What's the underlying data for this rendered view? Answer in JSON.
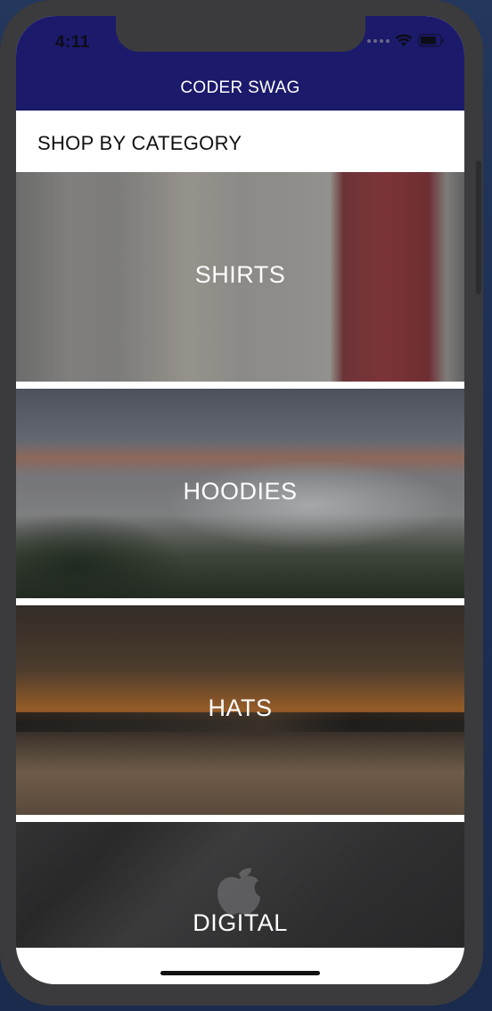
{
  "status_bar": {
    "time": "4:11",
    "icons": [
      "signal-dots-icon",
      "wifi-icon",
      "battery-icon"
    ]
  },
  "nav": {
    "title": "CODER SWAG"
  },
  "section": {
    "title": "SHOP BY CATEGORY"
  },
  "categories": [
    {
      "label": "SHIRTS"
    },
    {
      "label": "HOODIES"
    },
    {
      "label": "HATS"
    },
    {
      "label": "DIGITAL"
    }
  ],
  "colors": {
    "nav_background": "#1c1a6b",
    "text_on_image": "#ffffff"
  }
}
